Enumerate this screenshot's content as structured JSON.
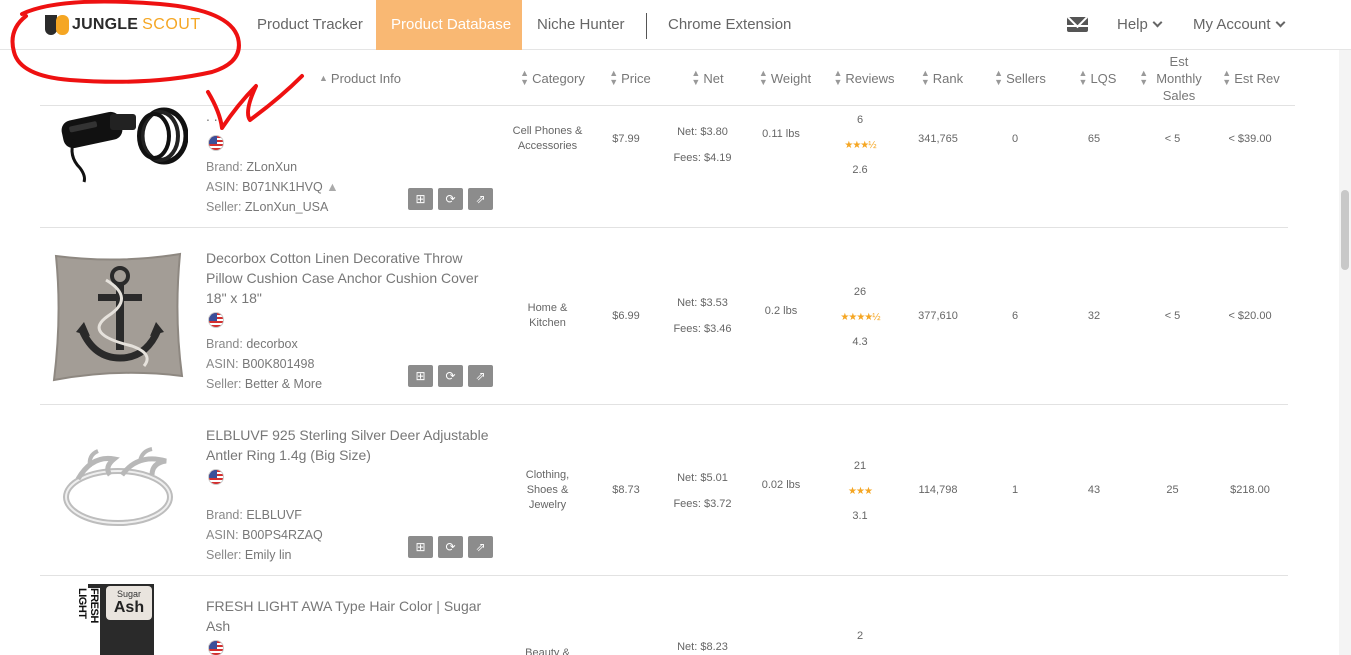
{
  "nav": {
    "logo_text1": "JUNGLE",
    "logo_text2": "SCOUT",
    "items": [
      {
        "label": "Product Tracker"
      },
      {
        "label": "Product Database",
        "active": true
      },
      {
        "label": "Niche Hunter"
      },
      {
        "label": "Chrome Extension"
      }
    ],
    "mail_icon": "envelope-icon",
    "help_label": "Help",
    "account_label": "My Account"
  },
  "table": {
    "headers": {
      "product_info": "Product Info",
      "category": "Category",
      "price": "Price",
      "net": "Net",
      "weight": "Weight",
      "reviews": "Reviews",
      "rank": "Rank",
      "sellers": "Sellers",
      "lqs": "LQS",
      "est_sales_1": "Est",
      "est_sales_2": "Monthly",
      "est_sales_3": "Sales",
      "est_rev": "Est Rev"
    },
    "rows": [
      {
        "name": "",
        "name_fragment": ". .",
        "brand_label": "Brand:",
        "brand": "ZLonXun",
        "asin_label": "ASIN:",
        "asin": "B071NK1HVQ",
        "seller_label": "Seller:",
        "seller": "ZLonXun_USA",
        "category": [
          "Cell Phones &",
          "Accessories"
        ],
        "price": "$7.99",
        "net": "Net: $3.80",
        "fees": "Fees: $4.19",
        "weight": "0.11 lbs",
        "reviews": "6",
        "stars": "★★★½",
        "rating": "2.6",
        "rank": "341,765",
        "sellers": "0",
        "lqs": "65",
        "sales": "< 5",
        "rev": "< $39.00"
      },
      {
        "name": "Decorbox Cotton Linen Decorative Throw Pillow Cushion Case Anchor Cushion Cover 18\" x 18\"",
        "brand_label": "Brand:",
        "brand": "decorbox",
        "asin_label": "ASIN:",
        "asin": "B00K801498",
        "seller_label": "Seller:",
        "seller": "Better & More",
        "category": [
          "Home &",
          "Kitchen"
        ],
        "price": "$6.99",
        "net": "Net: $3.53",
        "fees": "Fees: $3.46",
        "weight": "0.2 lbs",
        "reviews": "26",
        "stars": "★★★★½",
        "rating": "4.3",
        "rank": "377,610",
        "sellers": "6",
        "lqs": "32",
        "sales": "< 5",
        "rev": "< $20.00"
      },
      {
        "name": "ELBLUVF 925 Sterling Silver Deer Adjustable Antler Ring 1.4g (Big Size)",
        "brand_label": "Brand:",
        "brand": "ELBLUVF",
        "asin_label": "ASIN:",
        "asin": "B00PS4RZAQ",
        "seller_label": "Seller:",
        "seller": "Emily lin",
        "category": [
          "Clothing,",
          "Shoes &",
          "Jewelry"
        ],
        "price": "$8.73",
        "net": "Net: $5.01",
        "fees": "Fees: $3.72",
        "weight": "0.02 lbs",
        "reviews": "21",
        "stars": "★★★",
        "rating": "3.1",
        "rank": "114,798",
        "sellers": "1",
        "lqs": "43",
        "sales": "25",
        "rev": "$218.00"
      },
      {
        "name": "FRESH LIGHT AWA Type Hair Color | Sugar Ash",
        "category": [
          "Beauty &"
        ],
        "net": "Net: $8.23",
        "reviews": "2",
        "thumb_text1": "FRESH LIGHT",
        "thumb_text2": "Sugar",
        "thumb_text3": "Ash"
      }
    ]
  }
}
